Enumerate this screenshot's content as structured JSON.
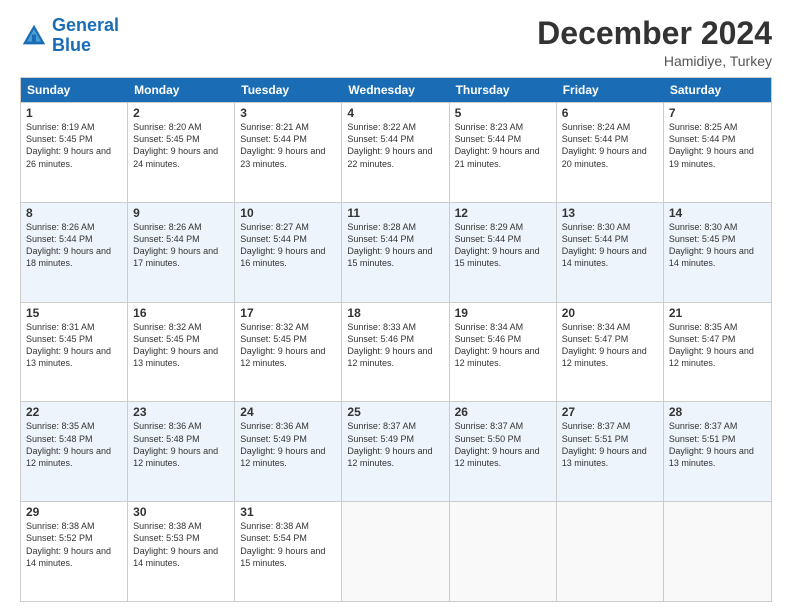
{
  "logo": {
    "line1": "General",
    "line2": "Blue"
  },
  "title": "December 2024",
  "location": "Hamidiye, Turkey",
  "header_days": [
    "Sunday",
    "Monday",
    "Tuesday",
    "Wednesday",
    "Thursday",
    "Friday",
    "Saturday"
  ],
  "weeks": [
    [
      {
        "day": "1",
        "sunrise": "Sunrise: 8:19 AM",
        "sunset": "Sunset: 5:45 PM",
        "daylight": "Daylight: 9 hours and 26 minutes."
      },
      {
        "day": "2",
        "sunrise": "Sunrise: 8:20 AM",
        "sunset": "Sunset: 5:45 PM",
        "daylight": "Daylight: 9 hours and 24 minutes."
      },
      {
        "day": "3",
        "sunrise": "Sunrise: 8:21 AM",
        "sunset": "Sunset: 5:44 PM",
        "daylight": "Daylight: 9 hours and 23 minutes."
      },
      {
        "day": "4",
        "sunrise": "Sunrise: 8:22 AM",
        "sunset": "Sunset: 5:44 PM",
        "daylight": "Daylight: 9 hours and 22 minutes."
      },
      {
        "day": "5",
        "sunrise": "Sunrise: 8:23 AM",
        "sunset": "Sunset: 5:44 PM",
        "daylight": "Daylight: 9 hours and 21 minutes."
      },
      {
        "day": "6",
        "sunrise": "Sunrise: 8:24 AM",
        "sunset": "Sunset: 5:44 PM",
        "daylight": "Daylight: 9 hours and 20 minutes."
      },
      {
        "day": "7",
        "sunrise": "Sunrise: 8:25 AM",
        "sunset": "Sunset: 5:44 PM",
        "daylight": "Daylight: 9 hours and 19 minutes."
      }
    ],
    [
      {
        "day": "8",
        "sunrise": "Sunrise: 8:26 AM",
        "sunset": "Sunset: 5:44 PM",
        "daylight": "Daylight: 9 hours and 18 minutes."
      },
      {
        "day": "9",
        "sunrise": "Sunrise: 8:26 AM",
        "sunset": "Sunset: 5:44 PM",
        "daylight": "Daylight: 9 hours and 17 minutes."
      },
      {
        "day": "10",
        "sunrise": "Sunrise: 8:27 AM",
        "sunset": "Sunset: 5:44 PM",
        "daylight": "Daylight: 9 hours and 16 minutes."
      },
      {
        "day": "11",
        "sunrise": "Sunrise: 8:28 AM",
        "sunset": "Sunset: 5:44 PM",
        "daylight": "Daylight: 9 hours and 15 minutes."
      },
      {
        "day": "12",
        "sunrise": "Sunrise: 8:29 AM",
        "sunset": "Sunset: 5:44 PM",
        "daylight": "Daylight: 9 hours and 15 minutes."
      },
      {
        "day": "13",
        "sunrise": "Sunrise: 8:30 AM",
        "sunset": "Sunset: 5:44 PM",
        "daylight": "Daylight: 9 hours and 14 minutes."
      },
      {
        "day": "14",
        "sunrise": "Sunrise: 8:30 AM",
        "sunset": "Sunset: 5:45 PM",
        "daylight": "Daylight: 9 hours and 14 minutes."
      }
    ],
    [
      {
        "day": "15",
        "sunrise": "Sunrise: 8:31 AM",
        "sunset": "Sunset: 5:45 PM",
        "daylight": "Daylight: 9 hours and 13 minutes."
      },
      {
        "day": "16",
        "sunrise": "Sunrise: 8:32 AM",
        "sunset": "Sunset: 5:45 PM",
        "daylight": "Daylight: 9 hours and 13 minutes."
      },
      {
        "day": "17",
        "sunrise": "Sunrise: 8:32 AM",
        "sunset": "Sunset: 5:45 PM",
        "daylight": "Daylight: 9 hours and 12 minutes."
      },
      {
        "day": "18",
        "sunrise": "Sunrise: 8:33 AM",
        "sunset": "Sunset: 5:46 PM",
        "daylight": "Daylight: 9 hours and 12 minutes."
      },
      {
        "day": "19",
        "sunrise": "Sunrise: 8:34 AM",
        "sunset": "Sunset: 5:46 PM",
        "daylight": "Daylight: 9 hours and 12 minutes."
      },
      {
        "day": "20",
        "sunrise": "Sunrise: 8:34 AM",
        "sunset": "Sunset: 5:47 PM",
        "daylight": "Daylight: 9 hours and 12 minutes."
      },
      {
        "day": "21",
        "sunrise": "Sunrise: 8:35 AM",
        "sunset": "Sunset: 5:47 PM",
        "daylight": "Daylight: 9 hours and 12 minutes."
      }
    ],
    [
      {
        "day": "22",
        "sunrise": "Sunrise: 8:35 AM",
        "sunset": "Sunset: 5:48 PM",
        "daylight": "Daylight: 9 hours and 12 minutes."
      },
      {
        "day": "23",
        "sunrise": "Sunrise: 8:36 AM",
        "sunset": "Sunset: 5:48 PM",
        "daylight": "Daylight: 9 hours and 12 minutes."
      },
      {
        "day": "24",
        "sunrise": "Sunrise: 8:36 AM",
        "sunset": "Sunset: 5:49 PM",
        "daylight": "Daylight: 9 hours and 12 minutes."
      },
      {
        "day": "25",
        "sunrise": "Sunrise: 8:37 AM",
        "sunset": "Sunset: 5:49 PM",
        "daylight": "Daylight: 9 hours and 12 minutes."
      },
      {
        "day": "26",
        "sunrise": "Sunrise: 8:37 AM",
        "sunset": "Sunset: 5:50 PM",
        "daylight": "Daylight: 9 hours and 12 minutes."
      },
      {
        "day": "27",
        "sunrise": "Sunrise: 8:37 AM",
        "sunset": "Sunset: 5:51 PM",
        "daylight": "Daylight: 9 hours and 13 minutes."
      },
      {
        "day": "28",
        "sunrise": "Sunrise: 8:37 AM",
        "sunset": "Sunset: 5:51 PM",
        "daylight": "Daylight: 9 hours and 13 minutes."
      }
    ],
    [
      {
        "day": "29",
        "sunrise": "Sunrise: 8:38 AM",
        "sunset": "Sunset: 5:52 PM",
        "daylight": "Daylight: 9 hours and 14 minutes."
      },
      {
        "day": "30",
        "sunrise": "Sunrise: 8:38 AM",
        "sunset": "Sunset: 5:53 PM",
        "daylight": "Daylight: 9 hours and 14 minutes."
      },
      {
        "day": "31",
        "sunrise": "Sunrise: 8:38 AM",
        "sunset": "Sunset: 5:54 PM",
        "daylight": "Daylight: 9 hours and 15 minutes."
      },
      null,
      null,
      null,
      null
    ]
  ]
}
